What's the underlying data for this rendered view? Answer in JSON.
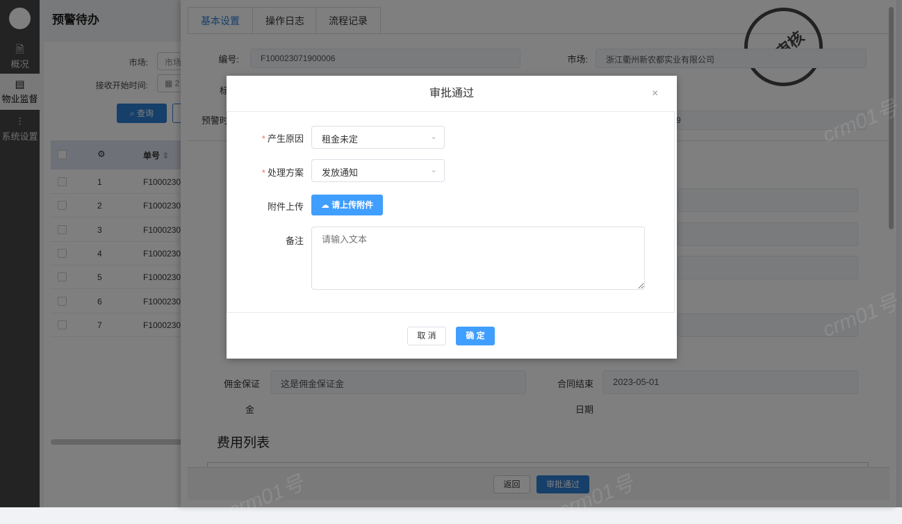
{
  "sidebar": {
    "items": [
      {
        "label": "概况",
        "icon": "file-icon"
      },
      {
        "label": "物业监督",
        "icon": "book-icon"
      },
      {
        "label": "系统设置",
        "icon": "sliders-icon"
      }
    ]
  },
  "page": {
    "title": "预警待办",
    "filters": {
      "market_label": "市场:",
      "market_value": "市场",
      "start_time_label": "接收开始时间:",
      "start_time_value": "2",
      "search_button": "查询"
    },
    "table": {
      "col_no": "单号",
      "rows": [
        {
          "idx": "1",
          "no": "F1000230"
        },
        {
          "idx": "2",
          "no": "F1000230"
        },
        {
          "idx": "3",
          "no": "F1000230"
        },
        {
          "idx": "4",
          "no": "F1000230"
        },
        {
          "idx": "5",
          "no": "F1000230"
        },
        {
          "idx": "6",
          "no": "F1000230"
        },
        {
          "idx": "7",
          "no": "F1000230"
        }
      ]
    }
  },
  "drawer": {
    "tabs": [
      "基本设置",
      "操作日志",
      "流程记录"
    ],
    "stamp": "未审核",
    "fields": {
      "no_label": "编号:",
      "no_value": "F100023071900006",
      "market_label": "市场:",
      "market_value": "浙江衢州新农都实业有限公司",
      "row2_label": "标",
      "warn_label": "预警时",
      "warn_value": "9",
      "deposit_label_1": "佣金保证",
      "deposit_label_2": "金",
      "deposit_value": "这是佣金保证金",
      "contract_end_label_1": "合同结束",
      "contract_end_label_2": "日期",
      "contract_end_value": "2023-05-01"
    },
    "fee_title": "费用列表",
    "footer": {
      "back": "返回",
      "approve": "审批通过"
    }
  },
  "watermark": "crm01号",
  "modal": {
    "title": "审批通过",
    "close": "×",
    "reason_label": "产生原因",
    "reason_value": "租金未定",
    "plan_label": "处理方案",
    "plan_value": "发放通知",
    "upload_label": "附件上传",
    "upload_button": "请上传附件",
    "remark_label": "备注",
    "remark_placeholder": "请输入文本",
    "cancel": "取 消",
    "confirm": "确 定"
  },
  "colors": {
    "primary": "#409eff",
    "required": "#f56c6c"
  }
}
